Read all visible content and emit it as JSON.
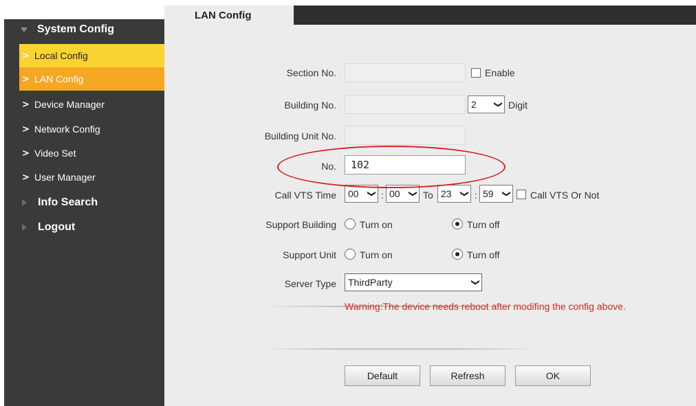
{
  "sidebar": {
    "system_config": "System Config",
    "items": [
      {
        "label": "Local Config"
      },
      {
        "label": "LAN Config"
      },
      {
        "label": "Device Manager"
      },
      {
        "label": "Network Config"
      },
      {
        "label": "Video Set"
      },
      {
        "label": "User Manager"
      }
    ],
    "info_search": "Info Search",
    "logout": "Logout"
  },
  "tab": {
    "label": "LAN Config"
  },
  "form": {
    "section_no": {
      "label": "Section No.",
      "value": "",
      "enable_label": "Enable"
    },
    "building_no": {
      "label": "Building No.",
      "value": "",
      "digit_value": "2",
      "digit_label": "Digit"
    },
    "building_unit_no": {
      "label": "Building Unit No.",
      "value": ""
    },
    "no": {
      "label": "No.",
      "value": "102"
    },
    "call_vts_time": {
      "label": "Call VTS Time",
      "start_hour": "00",
      "start_min": "00",
      "colon": ":",
      "to_label": "To",
      "end_hour": "23",
      "end_min": "59",
      "call_vts_label": "Call VTS Or Not"
    },
    "support_building": {
      "label": "Support Building",
      "on_label": "Turn on",
      "off_label": "Turn off",
      "selected": "off"
    },
    "support_unit": {
      "label": "Support Unit",
      "on_label": "Turn on",
      "off_label": "Turn off",
      "selected": "off"
    },
    "server_type": {
      "label": "Server Type",
      "value": "ThirdParty"
    }
  },
  "warning": "Warning:The device needs reboot after modifing the config above.",
  "buttons": {
    "default": "Default",
    "refresh": "Refresh",
    "ok": "OK"
  },
  "icons": {
    "dropdown": "chevron-down-icon",
    "nav": "chevron-right-icon"
  },
  "colors": {
    "sidebar_bg": "#3a3a3a",
    "active_yellow": "#f9d431",
    "active_orange": "#f5a623",
    "warning": "#e41e1e",
    "highlight": "#d42222"
  }
}
